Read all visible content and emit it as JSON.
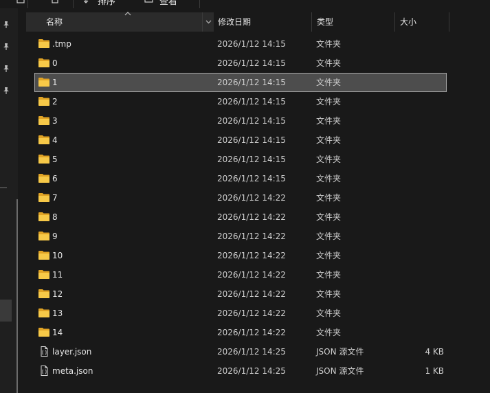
{
  "toolbar": {
    "frag_left": "排序",
    "frag_right": "查看"
  },
  "columns": {
    "name": "名称",
    "date": "修改日期",
    "type": "类型",
    "size": "大小"
  },
  "files": [
    {
      "name": ".tmp",
      "date": "2026/1/12 14:15",
      "type": "文件夹",
      "size": "",
      "kind": "folder",
      "icon": "folder-icon"
    },
    {
      "name": "0",
      "date": "2026/1/12 14:15",
      "type": "文件夹",
      "size": "",
      "kind": "folder",
      "icon": "folder-icon"
    },
    {
      "name": "1",
      "date": "2026/1/12 14:15",
      "type": "文件夹",
      "size": "",
      "kind": "folder",
      "icon": "folder-icon",
      "selected": true
    },
    {
      "name": "2",
      "date": "2026/1/12 14:15",
      "type": "文件夹",
      "size": "",
      "kind": "folder",
      "icon": "folder-icon"
    },
    {
      "name": "3",
      "date": "2026/1/12 14:15",
      "type": "文件夹",
      "size": "",
      "kind": "folder",
      "icon": "folder-icon"
    },
    {
      "name": "4",
      "date": "2026/1/12 14:15",
      "type": "文件夹",
      "size": "",
      "kind": "folder",
      "icon": "folder-icon"
    },
    {
      "name": "5",
      "date": "2026/1/12 14:15",
      "type": "文件夹",
      "size": "",
      "kind": "folder",
      "icon": "folder-icon"
    },
    {
      "name": "6",
      "date": "2026/1/12 14:15",
      "type": "文件夹",
      "size": "",
      "kind": "folder",
      "icon": "folder-icon"
    },
    {
      "name": "7",
      "date": "2026/1/12 14:22",
      "type": "文件夹",
      "size": "",
      "kind": "folder",
      "icon": "folder-icon"
    },
    {
      "name": "8",
      "date": "2026/1/12 14:22",
      "type": "文件夹",
      "size": "",
      "kind": "folder",
      "icon": "folder-icon"
    },
    {
      "name": "9",
      "date": "2026/1/12 14:22",
      "type": "文件夹",
      "size": "",
      "kind": "folder",
      "icon": "folder-icon"
    },
    {
      "name": "10",
      "date": "2026/1/12 14:22",
      "type": "文件夹",
      "size": "",
      "kind": "folder",
      "icon": "folder-icon"
    },
    {
      "name": "11",
      "date": "2026/1/12 14:22",
      "type": "文件夹",
      "size": "",
      "kind": "folder",
      "icon": "folder-icon"
    },
    {
      "name": "12",
      "date": "2026/1/12 14:22",
      "type": "文件夹",
      "size": "",
      "kind": "folder",
      "icon": "folder-icon"
    },
    {
      "name": "13",
      "date": "2026/1/12 14:22",
      "type": "文件夹",
      "size": "",
      "kind": "folder",
      "icon": "folder-icon"
    },
    {
      "name": "14",
      "date": "2026/1/12 14:22",
      "type": "文件夹",
      "size": "",
      "kind": "folder",
      "icon": "folder-icon"
    },
    {
      "name": "layer.json",
      "date": "2026/1/12 14:25",
      "type": "JSON 源文件",
      "size": "4 KB",
      "kind": "file",
      "icon": "json-file-icon"
    },
    {
      "name": "meta.json",
      "date": "2026/1/12 14:25",
      "type": "JSON 源文件",
      "size": "1 KB",
      "kind": "file",
      "icon": "json-file-icon"
    }
  ],
  "nav_pins": [
    "pin-icon",
    "pin-icon",
    "pin-icon",
    "pin-icon"
  ],
  "colors": {
    "background": "#191919",
    "header_active": "#2b2b2b",
    "selection": "#4d4d4d",
    "folder": "#f2c14e",
    "text": "#e6e6e6"
  }
}
